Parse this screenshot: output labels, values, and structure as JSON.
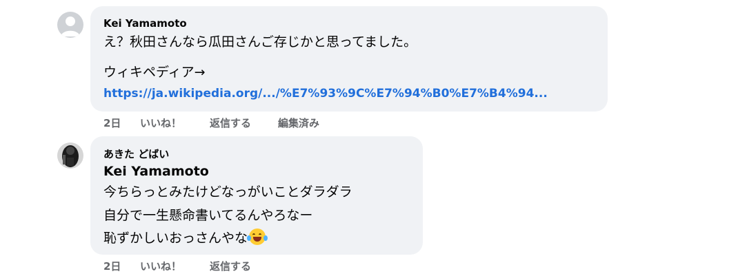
{
  "comments": [
    {
      "author": "Kei Yamamoto",
      "line1": "え？秋田さんなら瓜田さんご存じかと思ってました。",
      "line2": "ウィキペディア→",
      "link": "https://ja.wikipedia.org/.../%E7%93%9C%E7%94%B0%E7%B4%94...",
      "actions": {
        "time": "2日",
        "like": "いいね！",
        "reply": "返信する",
        "edited": "編集済み"
      }
    },
    {
      "author": "あきた どばい",
      "mention": "Kei Yamamoto",
      "line1": "今ちらっとみたけどなっがいことダラダラ",
      "line2": "自分で一生懸命書いてるんやろなー",
      "line3": "恥ずかしいおっさんやな",
      "emoji": "laughing-crying-emoji",
      "actions": {
        "time": "2日",
        "like": "いいね！",
        "reply": "返信する"
      }
    }
  ]
}
